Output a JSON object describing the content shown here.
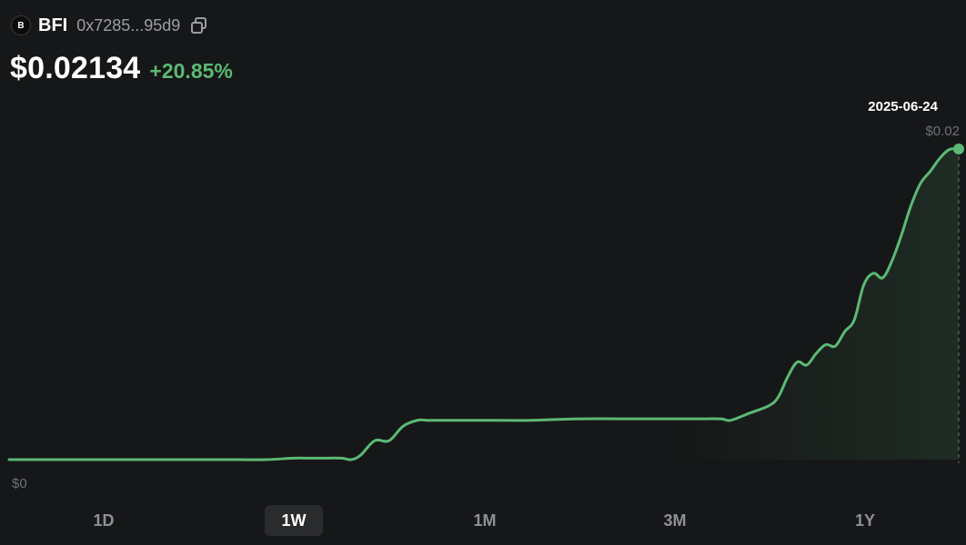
{
  "token": {
    "logo_letter": "B",
    "symbol": "BFI",
    "address": "0x7285...95d9"
  },
  "price": {
    "value": "$0.02134",
    "change": "+20.85%"
  },
  "tooltip": {
    "date": "2025-06-24",
    "value": "$0.02"
  },
  "axis": {
    "y_min_label": "$0"
  },
  "ranges": [
    {
      "label": "1D",
      "active": false
    },
    {
      "label": "1W",
      "active": true
    },
    {
      "label": "1M",
      "active": false
    },
    {
      "label": "3M",
      "active": false
    },
    {
      "label": "1Y",
      "active": false
    }
  ],
  "colors": {
    "line": "#5bb974",
    "background": "#161718",
    "positive": "#5bb974"
  },
  "chart_data": {
    "type": "line",
    "ylim": [
      0,
      0.02134
    ],
    "x": [
      0,
      3,
      6,
      9,
      12,
      15,
      18,
      21,
      24,
      27,
      30,
      31.5,
      33,
      35,
      36,
      37,
      38.5,
      40,
      41.5,
      43,
      44,
      45,
      46,
      47,
      50,
      55,
      60,
      65,
      70,
      73,
      75,
      76,
      78,
      80,
      81,
      82,
      83,
      84,
      85,
      86,
      87,
      88,
      89,
      90,
      91,
      92,
      93,
      94,
      95,
      96,
      97,
      98,
      99,
      100
    ],
    "y": [
      0.0,
      0.0,
      0.0,
      0.0,
      0.0,
      0.0,
      0.0,
      0.0,
      0.0,
      0.0,
      0.0001,
      0.0001,
      0.0001,
      0.0001,
      0.0,
      0.0003,
      0.0013,
      0.0013,
      0.0023,
      0.0027,
      0.0027,
      0.0027,
      0.0027,
      0.0027,
      0.0027,
      0.0027,
      0.0028,
      0.0028,
      0.0028,
      0.0028,
      0.0028,
      0.0027,
      0.0032,
      0.0037,
      0.0043,
      0.0057,
      0.0067,
      0.0065,
      0.0073,
      0.0079,
      0.0078,
      0.0088,
      0.0096,
      0.012,
      0.0128,
      0.0125,
      0.0137,
      0.0155,
      0.0175,
      0.019,
      0.0198,
      0.0207,
      0.0213,
      0.02134
    ]
  }
}
